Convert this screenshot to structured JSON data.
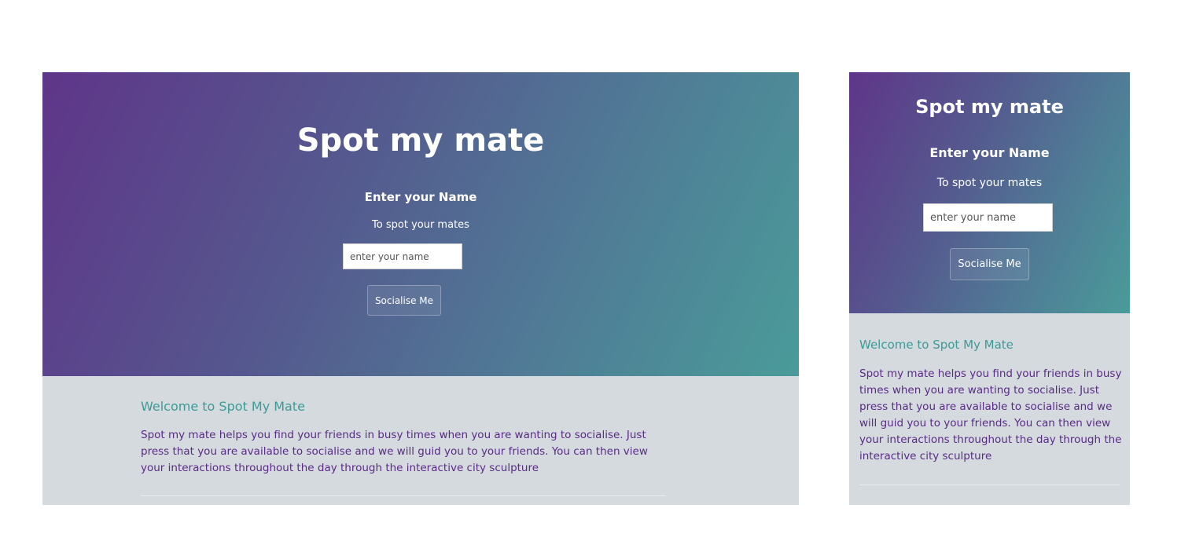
{
  "desktop": {
    "hero": {
      "title": "Spot my mate",
      "form_heading": "Enter your Name",
      "form_subtext": "To spot your mates",
      "name_input_placeholder": "enter your name",
      "submit_label": "Socialise Me"
    },
    "info": {
      "heading": "Welcome to Spot My Mate",
      "body": "Spot my mate helps you find your friends in busy times when you are wanting to socialise. Just press that you are available to socialise and we will guid you to your friends. You can then view your interactions throughout the day through the interactive city sculpture"
    }
  },
  "mobile": {
    "hero": {
      "title": "Spot my mate",
      "form_heading": "Enter your Name",
      "form_subtext": "To spot your mates",
      "name_input_placeholder": "enter your name",
      "submit_label": "Socialise Me"
    },
    "info": {
      "heading": "Welcome to Spot My Mate",
      "body": "Spot my mate helps you find your friends in busy times when you are wanting to socialise. Just press that you are available to socialise and we will guid you to your friends. You can then view your interactions throughout the day through the interactive city sculpture"
    }
  },
  "colors": {
    "gradient_start": "#5f3589",
    "gradient_end": "#4a9b99",
    "info_background": "#d5dadf",
    "heading_teal": "#3d9a95",
    "body_purple": "#5a2a86"
  }
}
